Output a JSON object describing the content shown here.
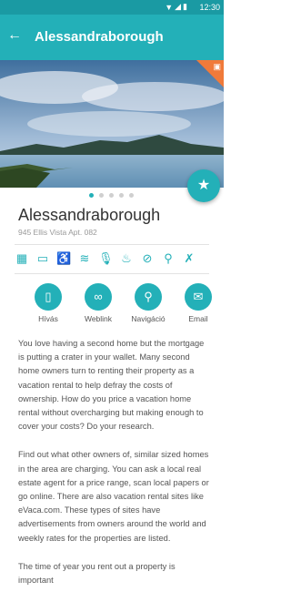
{
  "status_bar": {
    "time": "12:30"
  },
  "app_bar": {
    "title": "Alessandraborough",
    "back_icon": "arrow-left-icon"
  },
  "listing": {
    "name": "Alessandraborough",
    "address": "945 Ellis Vista Apt. 082",
    "image_count": 5,
    "active_image": 1
  },
  "amenities": [
    {
      "icon": "calendar-icon"
    },
    {
      "icon": "credit-card-icon"
    },
    {
      "icon": "wheelchair-icon"
    },
    {
      "icon": "pool-icon"
    },
    {
      "icon": "microphone-icon"
    },
    {
      "icon": "hot-tub-icon"
    },
    {
      "icon": "no-smoking-icon"
    },
    {
      "icon": "bicycle-icon"
    },
    {
      "icon": "pets-icon"
    }
  ],
  "actions": [
    {
      "label": "Hívás",
      "icon": "phone-icon"
    },
    {
      "label": "Weblink",
      "icon": "link-icon"
    },
    {
      "label": "Navigáció",
      "icon": "location-pin-icon"
    },
    {
      "label": "Email",
      "icon": "email-icon"
    }
  ],
  "description": [
    "You love having a second home but the mortgage is putting a crater in your wallet. Many second home owners turn to renting their property as a vacation rental to help defray the costs of ownership. How do you price a vacation home rental without overcharging but making enough to cover your costs? Do your research.",
    "Find out what other owners of, similar sized homes in the area are charging. You can ask a local real estate agent for a price range, scan local papers or go online. There are also vacation rental sites like eVaca.com. These types of sites have advertisements from owners around the world and weekly rates for the properties are listed.",
    "The time of year you rent out a property is important"
  ],
  "colors": {
    "primary": "#23b0b8",
    "status_bar": "#1a9aa3",
    "ribbon": "#f07a3a"
  }
}
